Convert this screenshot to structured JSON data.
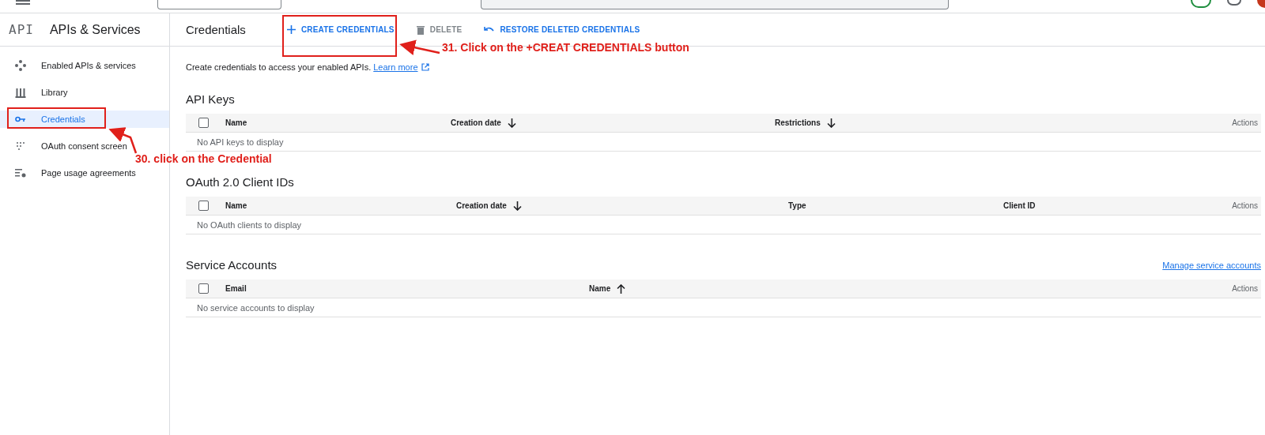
{
  "sidebar": {
    "title": "APIs & Services",
    "logo": "API",
    "items": [
      {
        "label": "Enabled APIs & services",
        "selected": false
      },
      {
        "label": "Library",
        "selected": false
      },
      {
        "label": "Credentials",
        "selected": true
      },
      {
        "label": "OAuth consent screen",
        "selected": false
      },
      {
        "label": "Page usage agreements",
        "selected": false
      }
    ]
  },
  "header": {
    "title": "Credentials",
    "actions": [
      {
        "label": "CREATE CREDENTIALS",
        "disabled": false
      },
      {
        "label": "DELETE",
        "disabled": true
      },
      {
        "label": "RESTORE DELETED CREDENTIALS",
        "disabled": false
      }
    ]
  },
  "intro": {
    "text": "Create credentials to access your enabled APIs.",
    "link": "Learn more"
  },
  "sections": [
    {
      "title": "API Keys",
      "checked": false,
      "columns": [
        {
          "label": "Name",
          "kind": "plain"
        },
        {
          "label": "Creation date",
          "kind": "descending"
        },
        {
          "label": "Restrictions",
          "kind": "descending"
        },
        {
          "label": "Actions",
          "kind": "plain"
        }
      ],
      "empty": "No API keys to display"
    },
    {
      "title": "OAuth 2.0 Client IDs",
      "checked": false,
      "columns": [
        {
          "label": "Name",
          "kind": "plain"
        },
        {
          "label": "Creation date",
          "kind": "descending"
        },
        {
          "label": "Type",
          "kind": "plain"
        },
        {
          "label": "Client ID",
          "kind": "plain"
        },
        {
          "label": "Actions",
          "kind": "plain"
        }
      ],
      "empty": "No OAuth clients to display"
    },
    {
      "title": "Service Accounts",
      "link": "Manage service accounts",
      "checked": false,
      "columns": [
        {
          "label": "Email",
          "kind": "plain"
        },
        {
          "label": "Name",
          "kind": "ascending"
        },
        {
          "label": "Actions",
          "kind": "plain"
        }
      ],
      "empty": "No service accounts to display"
    }
  ],
  "annotations": [
    {
      "text": "31. Click on the +CREAT CREDENTIALS button"
    },
    {
      "text": "30. click on the Credential"
    }
  ]
}
